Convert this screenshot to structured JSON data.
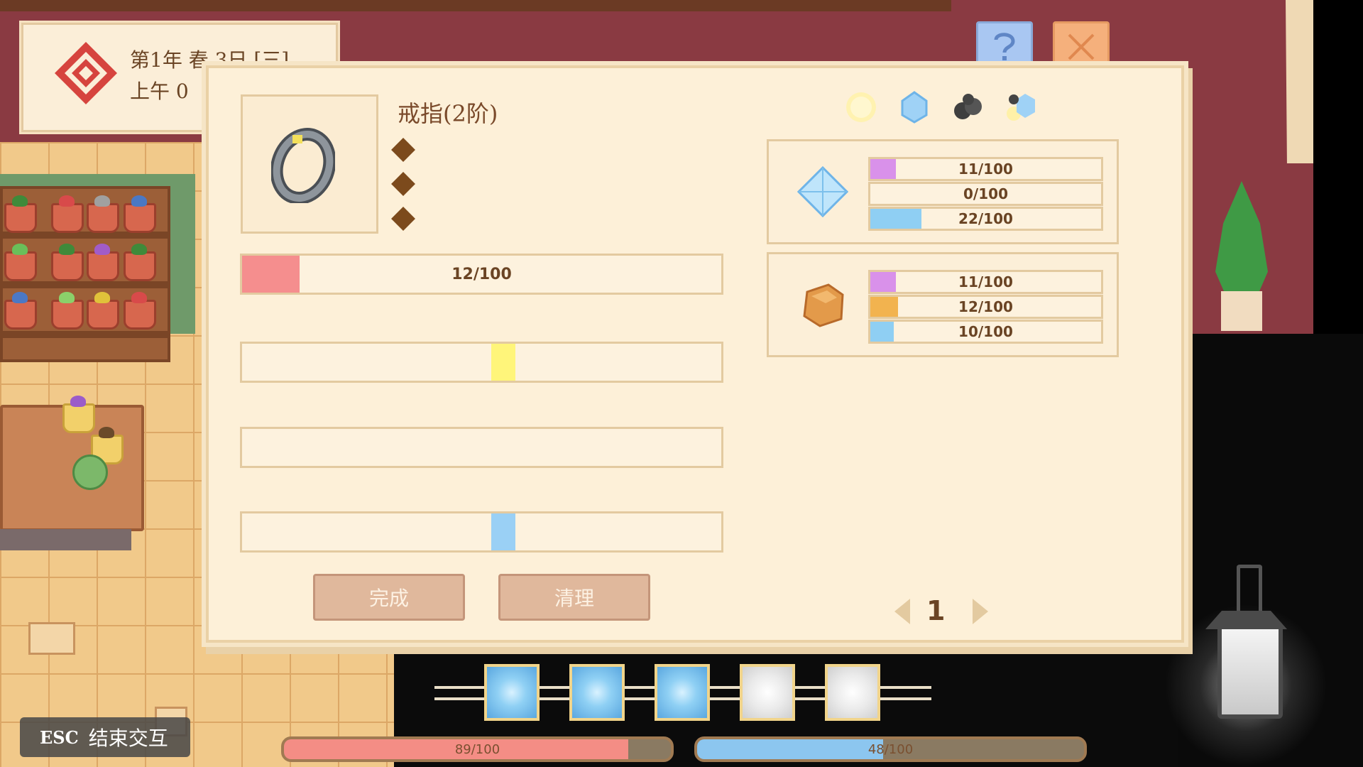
{
  "date": {
    "line1": "第1年 春 3日 [三]",
    "line2": "上午 0"
  },
  "item": {
    "name": "戒指(2阶)",
    "icon": "ring-icon",
    "traits": [
      "trait",
      "trait",
      "trait"
    ]
  },
  "progress": [
    {
      "text": "12/100",
      "fill_pct": 12,
      "color": "#f58e8e"
    },
    {
      "text": "",
      "marker_pct": 52,
      "marker_color": "#fff57a"
    },
    {
      "text": ""
    },
    {
      "text": "",
      "marker_pct": 52,
      "marker_color": "#9ad0f5"
    }
  ],
  "buttons": {
    "finish": "完成",
    "clear": "清理"
  },
  "pagination": {
    "page": "1"
  },
  "resource_icons": [
    "light-orb-icon",
    "blue-crystal-icon",
    "ore-icon",
    "mixed-element-icon"
  ],
  "materials": [
    {
      "icon": "crystal-icon",
      "bars": [
        {
          "text": "11/100",
          "fill_pct": 11,
          "color": "#d991ea"
        },
        {
          "text": "0/100",
          "fill_pct": 0,
          "color": "#d991ea"
        },
        {
          "text": "22/100",
          "fill_pct": 22,
          "color": "#8fcff3"
        }
      ]
    },
    {
      "icon": "amber-ore-icon",
      "bars": [
        {
          "text": "11/100",
          "fill_pct": 11,
          "color": "#d991ea"
        },
        {
          "text": "12/100",
          "fill_pct": 12,
          "color": "#f2b34f"
        },
        {
          "text": "10/100",
          "fill_pct": 10,
          "color": "#8fcff3"
        }
      ]
    }
  ],
  "hud": {
    "health": {
      "text": "89/100",
      "fill_pct": 89,
      "color": "#f48d85"
    },
    "mana": {
      "text": "48/100",
      "fill_pct": 48,
      "color": "#8cc6ef"
    },
    "slots": [
      "blue",
      "blue",
      "blue",
      "white",
      "white"
    ]
  },
  "esc": {
    "key": "ESC",
    "label": "结束交互"
  },
  "colors": {
    "panel_bg": "#fdf0d8",
    "panel_border": "#ead1a6",
    "text": "#6a4424",
    "wall": "#8a3a42"
  }
}
